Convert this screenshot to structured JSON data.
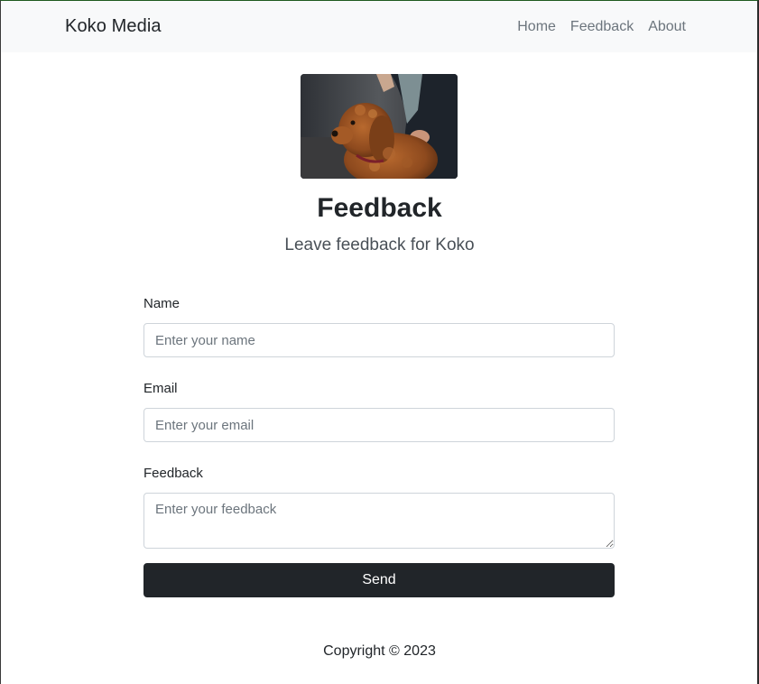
{
  "navbar": {
    "brand": "Koko Media",
    "links": [
      "Home",
      "Feedback",
      "About"
    ]
  },
  "hero": {
    "image_desc": "dog-photo"
  },
  "page": {
    "title": "Feedback",
    "subtitle": "Leave feedback for Koko"
  },
  "form": {
    "name_label": "Name",
    "name_placeholder": "Enter your name",
    "email_label": "Email",
    "email_placeholder": "Enter your email",
    "feedback_label": "Feedback",
    "feedback_placeholder": "Enter your feedback",
    "send_label": "Send"
  },
  "footer": {
    "copyright": "Copyright © 2023"
  },
  "colors": {
    "navbar_bg": "#f8f9fa",
    "button_bg": "#212529",
    "muted_text": "#6c757d"
  }
}
